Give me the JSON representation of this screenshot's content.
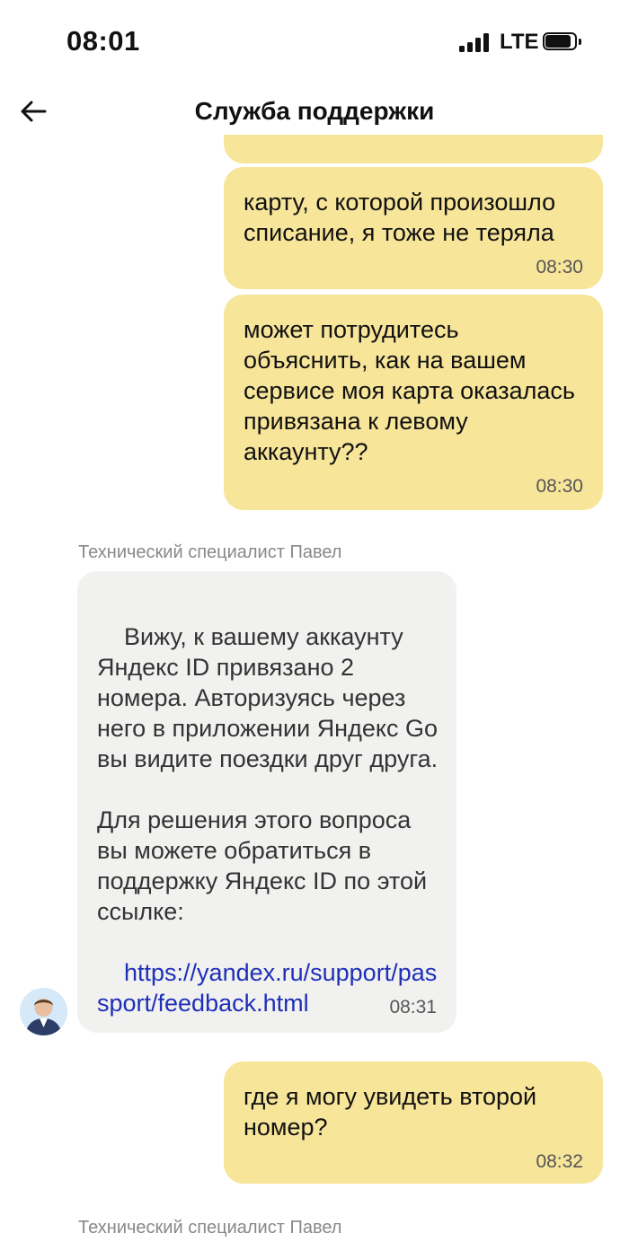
{
  "status_bar": {
    "time": "08:01",
    "network": "LTE"
  },
  "header": {
    "title": "Служба поддержки"
  },
  "messages": [
    {
      "text": "карту, с которой произошло списание, я тоже не теряла",
      "time": "08:30"
    },
    {
      "text": "может потрудитесь объяснить, как на вашем сервисе моя карта оказалась привязана к левому аккаунту??",
      "time": "08:30"
    },
    {
      "sender": "Технический специалист Павел",
      "text": "Вижу, к вашему аккаунту Яндекс ID привязано 2 номера. Авторизуясь через него в приложении Яндекс Go вы видите поездки друг друга.\n\nДля решения этого вопроса вы можете обратиться в поддержку Яндекс ID по этой ссылке:",
      "link": "https://yandex.ru/support/passport/feedback.html",
      "time": "08:31"
    },
    {
      "text": "где я могу увидеть второй номер?",
      "time": "08:32"
    }
  ],
  "next_sender": "Технический специалист Павел",
  "colors": {
    "outgoing_bubble": "#f7e59a",
    "incoming_bubble": "#f1f1f0",
    "link": "#1e2fb8"
  }
}
